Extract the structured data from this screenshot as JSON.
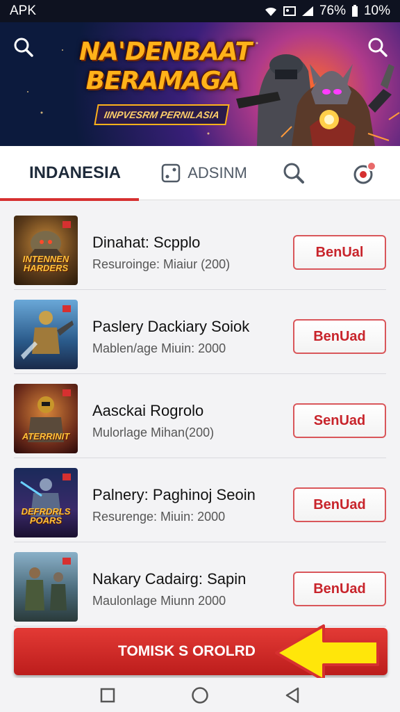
{
  "status": {
    "left_label": "APK",
    "battery_a": "76%",
    "battery_b": "10%"
  },
  "banner": {
    "title_line1": "NA'DENBAAT",
    "title_line2": "BERAMAGA",
    "subtitle": "IINPVESRM PERNILASIA"
  },
  "tabs": [
    {
      "label": "INDANESIA",
      "active": true
    },
    {
      "label": "ADSINM",
      "icon": "dice-icon"
    },
    {
      "icon": "search-icon"
    },
    {
      "icon": "record-icon"
    }
  ],
  "games": [
    {
      "title": "Dinahat: Scpplo",
      "subtitle": "Resuroinge: Miaiur (200)",
      "button": "BenUal",
      "thumb_text_1": "INTENNEN",
      "thumb_text_2": "HARDERS"
    },
    {
      "title": "Paslery Dackiary Soiok",
      "subtitle": "Mablen/age  Miuin: 2000",
      "button": "BenUad",
      "thumb_text_1": "",
      "thumb_text_2": ""
    },
    {
      "title": "Aasckai Rogrolo",
      "subtitle": "Mulorlage  Mihan(200)",
      "button": "SenUad",
      "thumb_text_1": "ATERRINIT",
      "thumb_text_2": ""
    },
    {
      "title": "Palnery: Paghinoj Seoin",
      "subtitle": "Resurenge: Miuin: 2000",
      "button": "BenUad",
      "thumb_text_1": "DEFRDRLS",
      "thumb_text_2": "POARS"
    },
    {
      "title": "Nakary Cadairg: Sapin",
      "subtitle": "Maulonlage  Miunn 2000",
      "button": "BenUad",
      "thumb_text_1": "",
      "thumb_text_2": ""
    }
  ],
  "bottom_button": {
    "label": "TOMISK S OROLRD"
  },
  "colors": {
    "accent": "#d63030",
    "button_red": "#c8242b",
    "banner_gold": "#ffb21a",
    "arrow_yellow": "#ffe60a"
  }
}
